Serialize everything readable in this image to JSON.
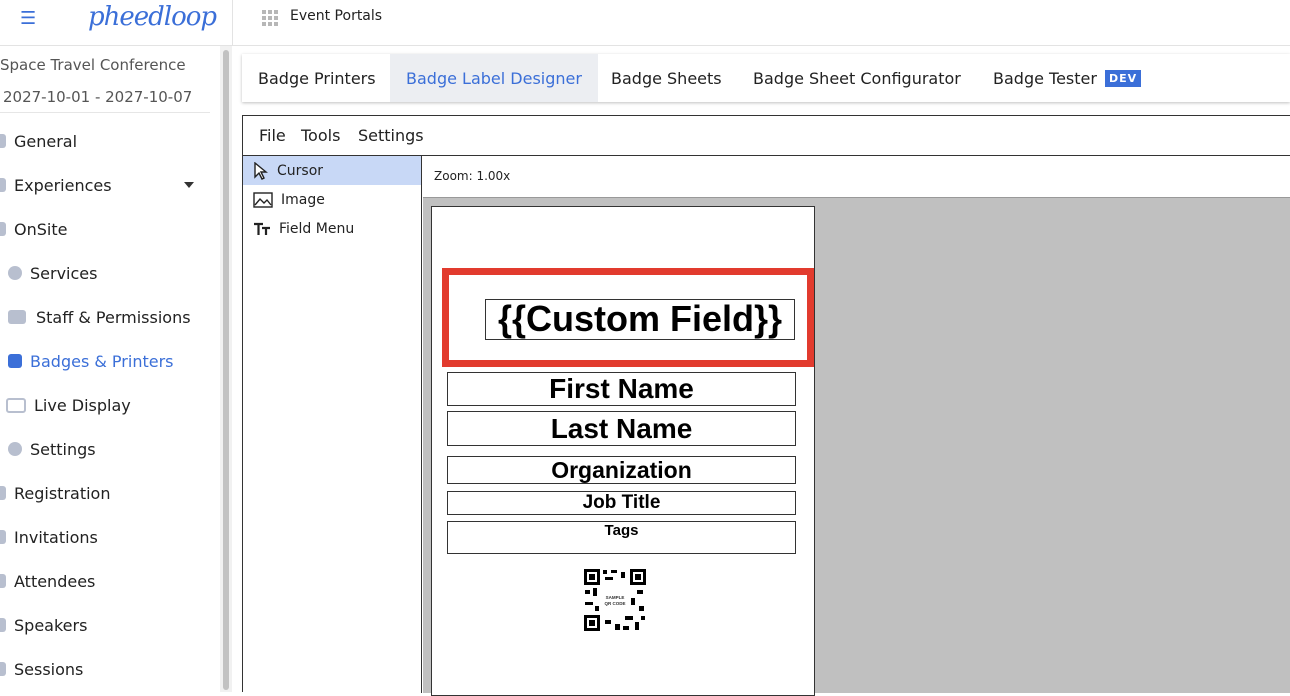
{
  "app": {
    "logo_text": "pheedloop",
    "portal_title": "Event Portals"
  },
  "sidebar": {
    "conference_name": "Space Travel Conference",
    "conference_dates": "2027-10-01 - 2027-10-07",
    "items": [
      {
        "label": "General"
      },
      {
        "label": "Experiences"
      },
      {
        "label": "OnSite"
      },
      {
        "label": "Services"
      },
      {
        "label": "Staff & Permissions"
      },
      {
        "label": "Badges & Printers"
      },
      {
        "label": "Live Display"
      },
      {
        "label": "Settings"
      },
      {
        "label": "Registration"
      },
      {
        "label": "Invitations"
      },
      {
        "label": "Attendees"
      },
      {
        "label": "Speakers"
      },
      {
        "label": "Sessions"
      }
    ]
  },
  "tabs": [
    {
      "label": "Badge Printers"
    },
    {
      "label": "Badge Label Designer"
    },
    {
      "label": "Badge Sheets"
    },
    {
      "label": "Badge Sheet Configurator"
    },
    {
      "label": "Badge Tester",
      "badge": "DEV"
    }
  ],
  "designer": {
    "menus": [
      "File",
      "Tools",
      "Settings"
    ],
    "tools": [
      {
        "label": "Cursor",
        "icon": "cursor-icon"
      },
      {
        "label": "Image",
        "icon": "image-icon"
      },
      {
        "label": "Field Menu",
        "icon": "text-icon"
      }
    ],
    "zoom": "Zoom: 1.00x",
    "badge_fields": [
      {
        "label": "{{Custom Field}}"
      },
      {
        "label": "First Name"
      },
      {
        "label": "Last Name"
      },
      {
        "label": "Organization"
      },
      {
        "label": "Job Title"
      },
      {
        "label": "Tags"
      }
    ],
    "qr_text": "SAMPLE QR CODE"
  },
  "colors": {
    "accent": "#3b6fd8",
    "highlight": "#e23b2e",
    "active_tool": "#c8d8f6",
    "canvas_bg": "#c0c0c0"
  }
}
